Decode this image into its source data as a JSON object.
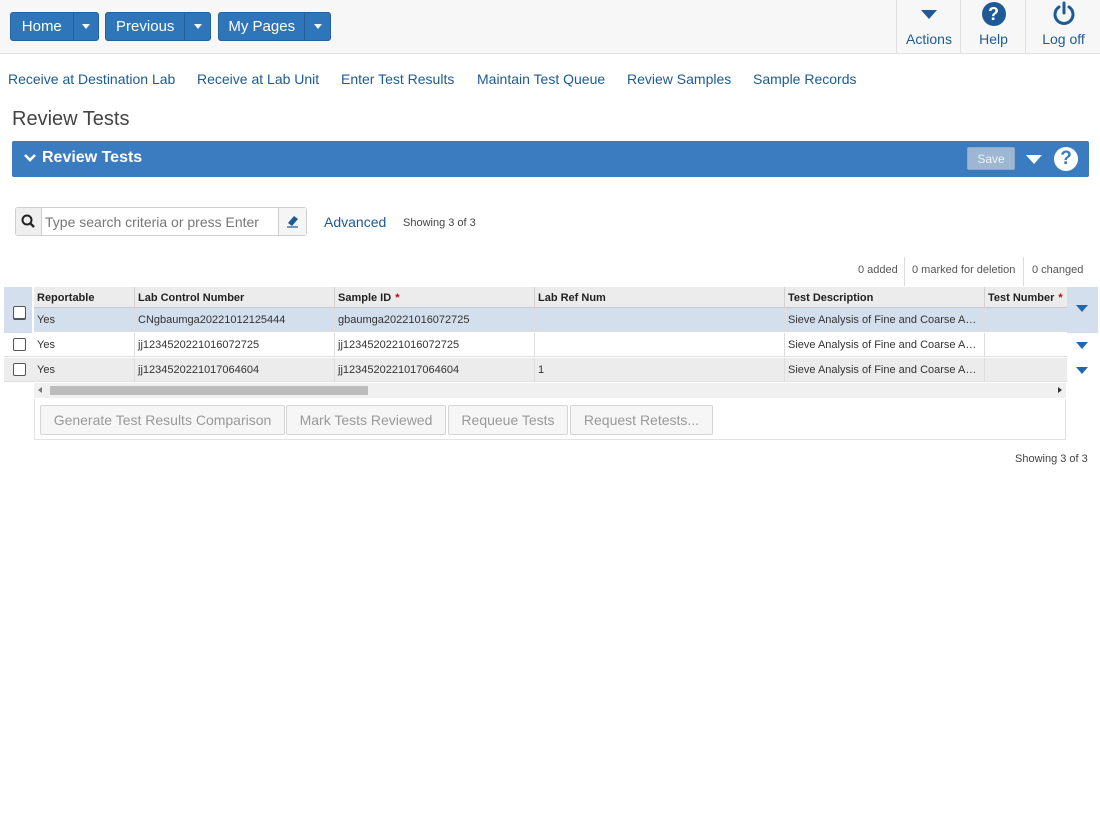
{
  "topnav": {
    "home": "Home",
    "previous": "Previous",
    "my_pages": "My Pages",
    "actions": "Actions",
    "help": "Help",
    "logoff": "Log off"
  },
  "links": [
    "Receive at Destination Lab",
    "Receive at Lab Unit",
    "Enter Test Results",
    "Maintain Test Queue",
    "Review Samples",
    "Sample Records"
  ],
  "page_title": "Review Tests",
  "panel": {
    "title": "Review Tests",
    "save": "Save",
    "help": "?"
  },
  "search": {
    "placeholder": "Type search criteria or press Enter",
    "value": "",
    "advanced": "Advanced",
    "showing": "Showing 3 of 3"
  },
  "counts": {
    "added": "0 added",
    "deleted": "0 marked for deletion",
    "changed": "0 changed"
  },
  "grid": {
    "columns": [
      "Reportable",
      "Lab Control Number",
      "Sample ID",
      "Lab Ref Num",
      "Test Description",
      "Test Number"
    ],
    "rows": [
      [
        "Yes",
        "CNgbaumga20221012125444",
        "gbaumga20221016072725",
        "",
        "Sieve Analysis of Fine and Coarse Aggregates",
        ""
      ],
      [
        "Yes",
        "jj1234520221016072725",
        "jj1234520221016072725",
        "",
        "Sieve Analysis of Fine and Coarse Aggregates",
        ""
      ],
      [
        "Yes",
        "jj1234520221017064604",
        "jj1234520221017064604",
        "1",
        "Sieve Analysis of Fine and Coarse Aggregates",
        ""
      ]
    ]
  },
  "buttons": {
    "generate": "Generate Test Results Comparison",
    "mark": "Mark Tests Reviewed",
    "requeue": "Requeue Tests",
    "retest": "Request Retests..."
  },
  "showing_bottom": "Showing 3 of 3",
  "colors": {
    "primary": "#2f75b9",
    "panel": "#3b7bbf",
    "link": "#1d5a94",
    "selected_row": "#d3dfec",
    "required": "#cc0000"
  }
}
